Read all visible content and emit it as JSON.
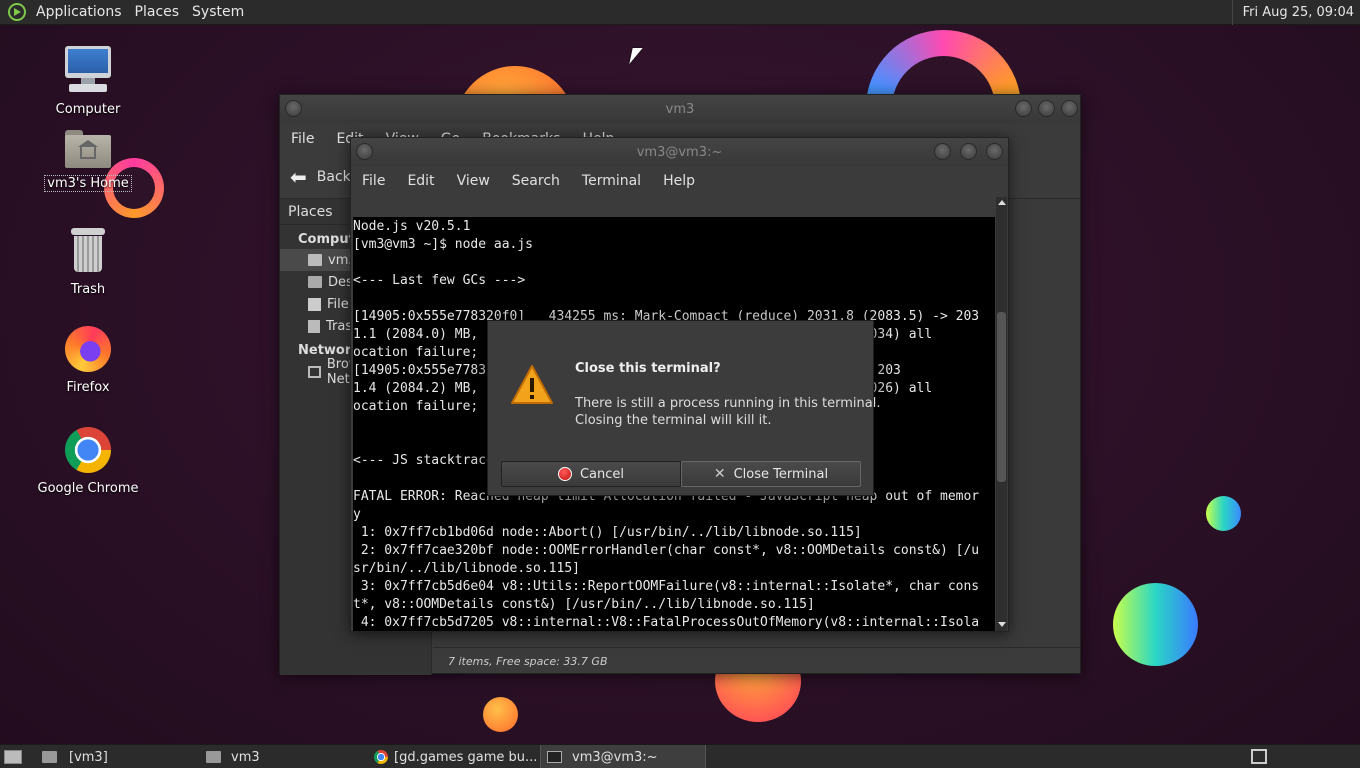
{
  "top_panel": {
    "menus": [
      "Applications",
      "Places",
      "System"
    ],
    "clock": "Fri Aug 25, 09:04"
  },
  "desktop_icons": [
    {
      "label": "Computer",
      "icon": "computer-icon"
    },
    {
      "label": "vm3's Home",
      "icon": "home-folder-icon"
    },
    {
      "label": "Trash",
      "icon": "trash-icon"
    },
    {
      "label": "Firefox",
      "icon": "firefox-icon"
    },
    {
      "label": "Google Chrome",
      "icon": "chrome-icon"
    }
  ],
  "file_manager": {
    "title": "vm3",
    "menus": [
      "File",
      "Edit",
      "View",
      "Go",
      "Bookmarks",
      "Help"
    ],
    "back_label": "Back",
    "sidebar_header": "Places",
    "sidebar": {
      "computer_header": "Computer",
      "items": [
        "vm3",
        "Desktop",
        "File System",
        "Trash"
      ],
      "network_header": "Network",
      "network_items": [
        "Browse Network"
      ]
    },
    "status": "7 items, Free space: 33.7 GB"
  },
  "terminal": {
    "title": "vm3@vm3:~",
    "menus": [
      "File",
      "Edit",
      "View",
      "Search",
      "Terminal",
      "Help"
    ],
    "lines": [
      "Node.js v20.5.1",
      "[vm3@vm3 ~]$ node aa.js",
      "",
      "<--- Last few GCs --->",
      "",
      "[14905:0x555e778320f0]   434255 ms: Mark-Compact (reduce) 2031.8 (2083.5) -> 203",
      "1.1 (2084.0) MB, pooled: 0 MB, 1104.87 / 0.00 ms  (average mu = 0.034) all",
      "ocation failure; scavenge might not succeed",
      "[14905:0x555e77832... ms: Mark-Compact (reduce) 2031.8 (2084.0) -> 203",
      "1.4 (2084.2) MB, pooled: 0 MB, 1103.51 / 0.00 ms  (average mu = 0.026) all",
      "ocation failure; scavenge might not succeed",
      "",
      "",
      "<--- JS stacktrace --->",
      "",
      "FATAL ERROR: Reached heap limit Allocation failed - JavaScript heap out of memor",
      "y",
      " 1: 0x7ff7cb1bd06d node::Abort() [/usr/bin/../lib/libnode.so.115]",
      " 2: 0x7ff7cae320bf node::OOMErrorHandler(char const*, v8::OOMDetails const&) [/u",
      "sr/bin/../lib/libnode.so.115]",
      " 3: 0x7ff7cb5d6e04 v8::Utils::ReportOOMFailure(v8::internal::Isolate*, char cons",
      "t*, v8::OOMDetails const&) [/usr/bin/../lib/libnode.so.115]",
      " 4: 0x7ff7cb5d7205 v8::internal::V8::FatalProcessOutOfMemory(v8::internal::Isola"
    ]
  },
  "dialog": {
    "heading": "Close this terminal?",
    "body_line1": "There is still a process running in this terminal.",
    "body_line2": "Closing the terminal will kill it.",
    "cancel_label": "Cancel",
    "close_label": "Close Terminal"
  },
  "taskbar": {
    "tasks": [
      "[vm3]",
      "vm3",
      "[gd.games game bu...",
      "vm3@vm3:~"
    ]
  }
}
